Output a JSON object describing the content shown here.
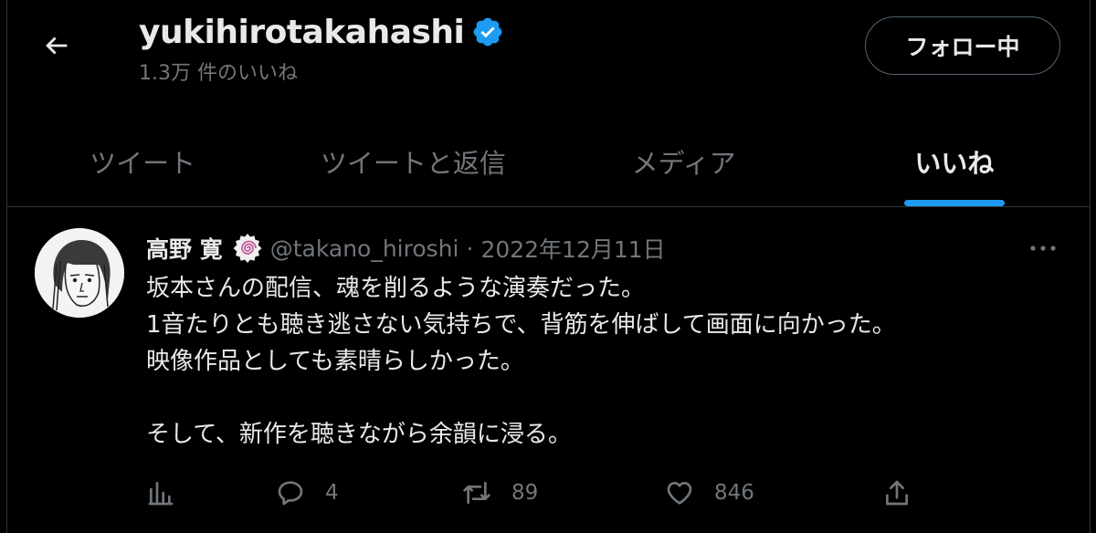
{
  "header": {
    "profile_name": "yukihirotakahashi",
    "likes_count_text": "1.3万 件のいいね",
    "follow_button_label": "フォロー中"
  },
  "tabs": [
    {
      "label": "ツイート",
      "active": false
    },
    {
      "label": "ツイートと返信",
      "active": false
    },
    {
      "label": "メディア",
      "active": false
    },
    {
      "label": "いいね",
      "active": true
    }
  ],
  "tweet": {
    "author_name": "高野 寛",
    "handle": "@takano_hiroshi",
    "separator": "·",
    "date": "2022年12月11日",
    "lines": [
      "坂本さんの配信、魂を削るような演奏だった。",
      "1音たりとも聴き逃さない気持ちで、背筋を伸ばして画面に向かった。",
      "映像作品としても素晴らしかった。",
      "",
      "そして、新作を聴きながら余韻に浸る。"
    ],
    "actions": {
      "replies": "4",
      "retweets": "89",
      "likes": "846"
    }
  },
  "colors": {
    "background": "#000000",
    "text_primary": "#e7e9ea",
    "text_secondary": "#71767b",
    "accent": "#1d9bf0",
    "divider": "#2f3336"
  },
  "icons": {
    "back": "back-arrow-icon",
    "verified": "verified-badge-icon",
    "org_badge": "spiral-badge-icon",
    "more": "more-dots-icon",
    "analytics": "analytics-icon",
    "reply": "reply-icon",
    "retweet": "retweet-icon",
    "like": "heart-icon",
    "share": "share-icon"
  }
}
